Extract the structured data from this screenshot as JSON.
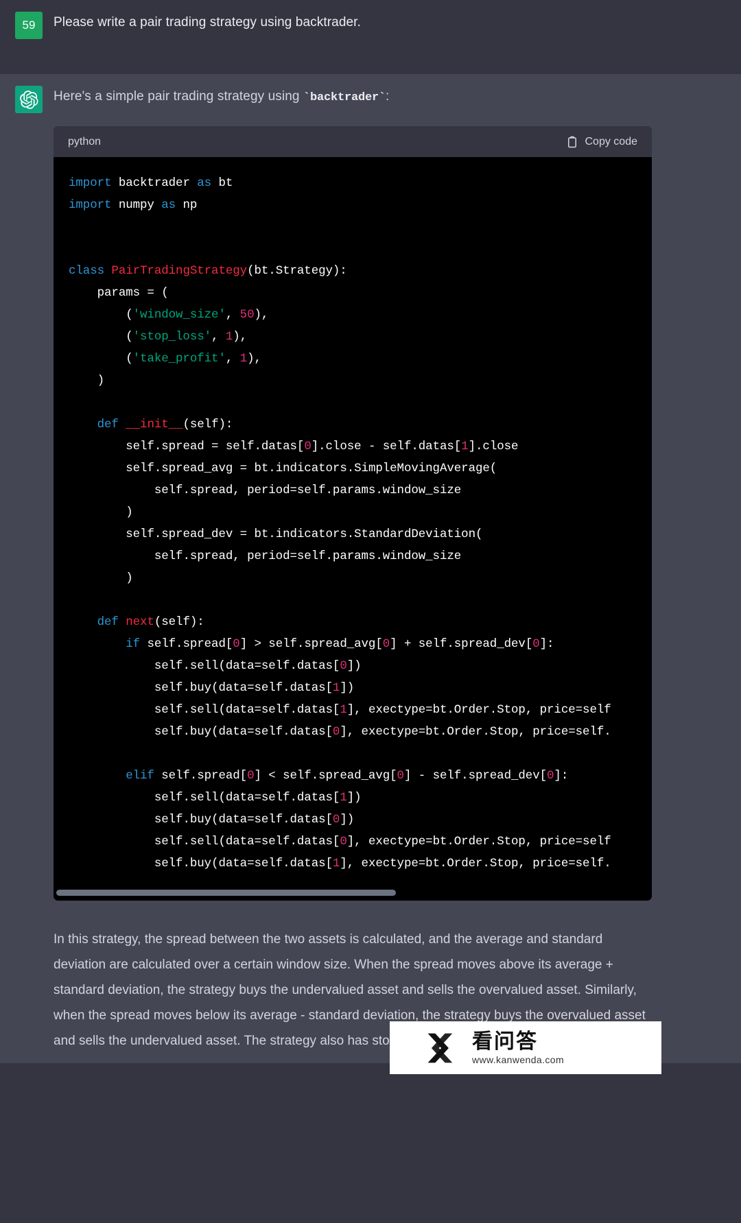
{
  "conversation": {
    "user_turn": {
      "avatar_label": "59",
      "avatar_icon": "user-badge-icon",
      "message": "Please write a pair trading strategy using backtrader."
    },
    "assistant_turn": {
      "avatar_icon": "openai-logo-icon",
      "intro_prefix": "Here's a simple pair trading strategy using ",
      "intro_code": "backtrader",
      "intro_suffix": ":",
      "closing": "In this strategy, the spread between the two assets is calculated, and the average and standard deviation are calculated over a certain window size. When the spread moves above its average + standard deviation, the strategy buys the undervalued asset and sells the overvalued asset. Similarly, when the spread moves below its average - standard deviation, the strategy buys the overvalued asset and sells the undervalued asset. The strategy also has stop loss and take profit parameters."
    }
  },
  "code_block": {
    "language": "python",
    "copy_label": "Copy code",
    "copy_icon": "clipboard-icon",
    "scrollbar": "horizontal-scrollbar",
    "lines": [
      "import backtrader as bt",
      "import numpy as np",
      "",
      "",
      "class PairTradingStrategy(bt.Strategy):",
      "    params = (",
      "        ('window_size', 50),",
      "        ('stop_loss', 1),",
      "        ('take_profit', 1),",
      "    )",
      "",
      "    def __init__(self):",
      "        self.spread = self.datas[0].close - self.datas[1].close",
      "        self.spread_avg = bt.indicators.SimpleMovingAverage(",
      "            self.spread, period=self.params.window_size",
      "        )",
      "        self.spread_dev = bt.indicators.StandardDeviation(",
      "            self.spread, period=self.params.window_size",
      "        )",
      "",
      "    def next(self):",
      "        if self.spread[0] > self.spread_avg[0] + self.spread_dev[0]:",
      "            self.sell(data=self.datas[0])",
      "            self.buy(data=self.datas[1])",
      "            self.sell(data=self.datas[1], exectype=bt.Order.Stop, price=self",
      "            self.buy(data=self.datas[0], exectype=bt.Order.Stop, price=self.",
      "",
      "        elif self.spread[0] < self.spread_avg[0] - self.spread_dev[0]:",
      "            self.sell(data=self.datas[1])",
      "            self.buy(data=self.datas[0])",
      "            self.sell(data=self.datas[0], exectype=bt.Order.Stop, price=self",
      "            self.buy(data=self.datas[1], exectype=bt.Order.Stop, price=self."
    ]
  },
  "watermark": {
    "title": "看问答",
    "url": "www.kanwenda.com",
    "logo_icon": "kanwenda-logo-icon"
  },
  "colors": {
    "user_bg": "#343541",
    "assistant_bg": "#444654",
    "user_avatar": "#1fa661",
    "assistant_avatar": "#10a37f",
    "code_bg": "#000000",
    "keyword": "#2e95d3",
    "name": "#f22c3d",
    "string": "#00a67d",
    "number": "#df3079",
    "text": "#d1d5db"
  }
}
